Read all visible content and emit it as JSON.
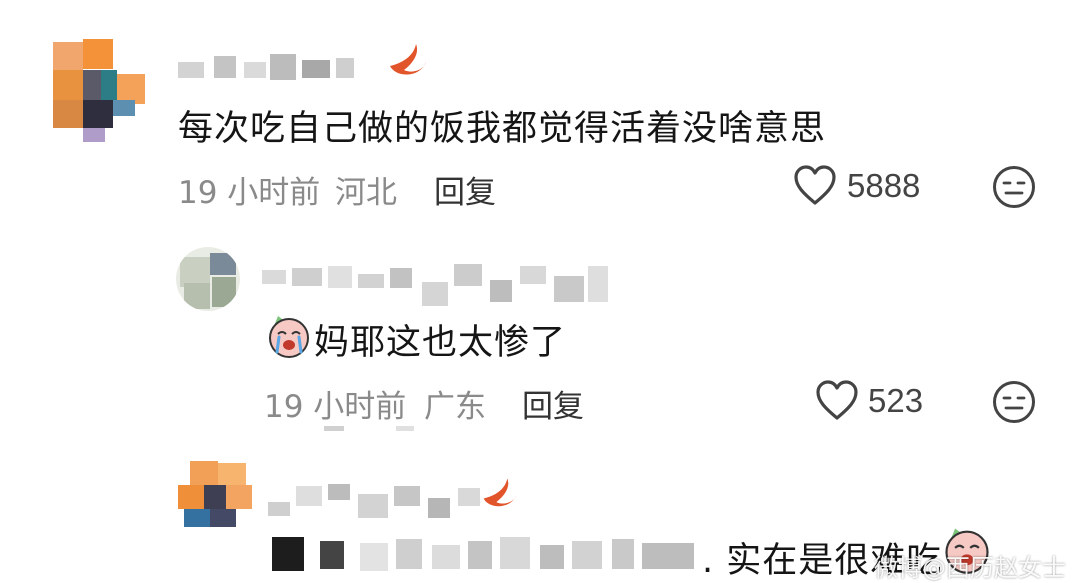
{
  "comments": [
    {
      "text": "每次吃自己做的饭我都觉得活着没啥意思",
      "time": "19 小时前",
      "location": "河北",
      "reply_label": "回复",
      "likes": "5888"
    },
    {
      "text": "妈耶这也太惨了",
      "time": "19 小时前",
      "location": "广东",
      "reply_label": "回复",
      "likes": "523"
    },
    {
      "text": ". 实在是很难吃",
      "sticker": "crying-sticker"
    }
  ],
  "watermark": "微博@西历赵女士",
  "icons": {
    "like": "heart-icon",
    "more": "face-icon"
  },
  "colors": {
    "meta_text": "#8a8a8a",
    "comment_text": "#151515"
  }
}
